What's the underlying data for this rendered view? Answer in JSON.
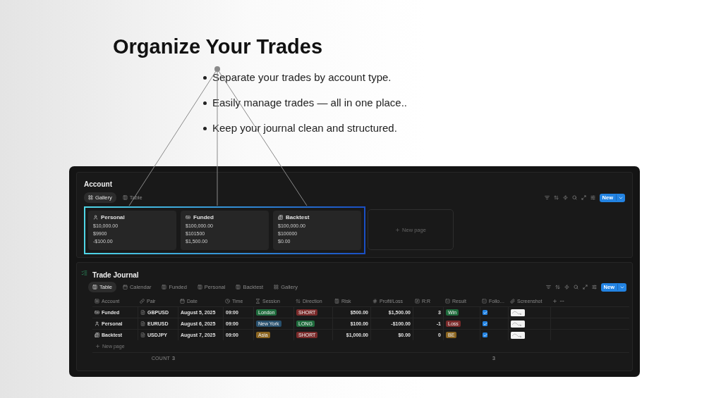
{
  "headline": "Organize Your Trades",
  "bullets": [
    "Separate your trades by account type.",
    "Easily manage trades — all in one place..",
    "Keep your journal clean and structured."
  ],
  "account": {
    "title": "Account",
    "views": [
      {
        "label": "Gallery",
        "kind": "gallery",
        "selected": true
      },
      {
        "label": "Table",
        "kind": "table",
        "selected": false
      }
    ],
    "new_button": "New",
    "cards": [
      {
        "kind": "person",
        "name": "Personal",
        "lines": [
          "$10,000.00",
          "$9900",
          "-$100.00"
        ]
      },
      {
        "kind": "cash",
        "name": "Funded",
        "lines": [
          "$100,000.00",
          "$101500",
          "$1,500.00"
        ]
      },
      {
        "kind": "news",
        "name": "Backtest",
        "lines": [
          "$100,000.00",
          "$100000",
          "$0.00"
        ]
      }
    ],
    "new_page": "New page"
  },
  "journal": {
    "title": "Trade Journal",
    "views": [
      {
        "label": "Table",
        "kind": "table",
        "selected": true
      },
      {
        "label": "Calendar",
        "kind": "calendar",
        "selected": false
      },
      {
        "label": "Funded",
        "kind": "table",
        "selected": false
      },
      {
        "label": "Personal",
        "kind": "table",
        "selected": false
      },
      {
        "label": "Backtest",
        "kind": "table",
        "selected": false
      },
      {
        "label": "Gallery",
        "kind": "gallery",
        "selected": false
      }
    ],
    "new_button": "New",
    "columns": [
      {
        "label": "Account",
        "kind": "account"
      },
      {
        "label": "Pair",
        "kind": "pair"
      },
      {
        "label": "Date",
        "kind": "date"
      },
      {
        "label": "Time",
        "kind": "time"
      },
      {
        "label": "Session",
        "kind": "session"
      },
      {
        "label": "Direction",
        "kind": "direction"
      },
      {
        "label": "Risk",
        "kind": "risk"
      },
      {
        "label": "Profit/Loss",
        "kind": "number"
      },
      {
        "label": "R:R",
        "kind": "formula"
      },
      {
        "label": "Result",
        "kind": "select"
      },
      {
        "label": "Follo…",
        "kind": "checkbox"
      },
      {
        "label": "Screenshot",
        "kind": "file"
      }
    ],
    "rows": [
      {
        "account": {
          "kind": "cash",
          "name": "Funded"
        },
        "pair": "GBPUSD",
        "date": "August 5, 2025",
        "time": "09:00",
        "session": {
          "text": "London",
          "color": "#1f6b3c"
        },
        "direction": {
          "text": "SHORT",
          "color": "#7a2a2a"
        },
        "risk": "$500.00",
        "pnl": "$1,500.00",
        "rr": "3",
        "result": {
          "text": "Win",
          "color": "#1f6b3c"
        },
        "followed": true
      },
      {
        "account": {
          "kind": "person",
          "name": "Personal"
        },
        "pair": "EURUSD",
        "date": "August 6, 2025",
        "time": "09:00",
        "session": {
          "text": "New York",
          "color": "#28506e"
        },
        "direction": {
          "text": "LONG",
          "color": "#1f6b3c"
        },
        "risk": "$100.00",
        "pnl": "-$100.00",
        "rr": "-1",
        "result": {
          "text": "Loss",
          "color": "#7a2a2a"
        },
        "followed": true
      },
      {
        "account": {
          "kind": "news",
          "name": "Backtest"
        },
        "pair": "USDJPY",
        "date": "August 7, 2025",
        "time": "09:00",
        "session": {
          "text": "Asia",
          "color": "#8a6420"
        },
        "direction": {
          "text": "SHORT",
          "color": "#7a2a2a"
        },
        "risk": "$1,000.00",
        "pnl": "$0.00",
        "rr": "0",
        "result": {
          "text": "BE",
          "color": "#8a6420"
        },
        "followed": true
      }
    ],
    "new_row": "New page",
    "footer": {
      "count_label": "COUNT",
      "count": "3",
      "checked_count": "3"
    }
  }
}
